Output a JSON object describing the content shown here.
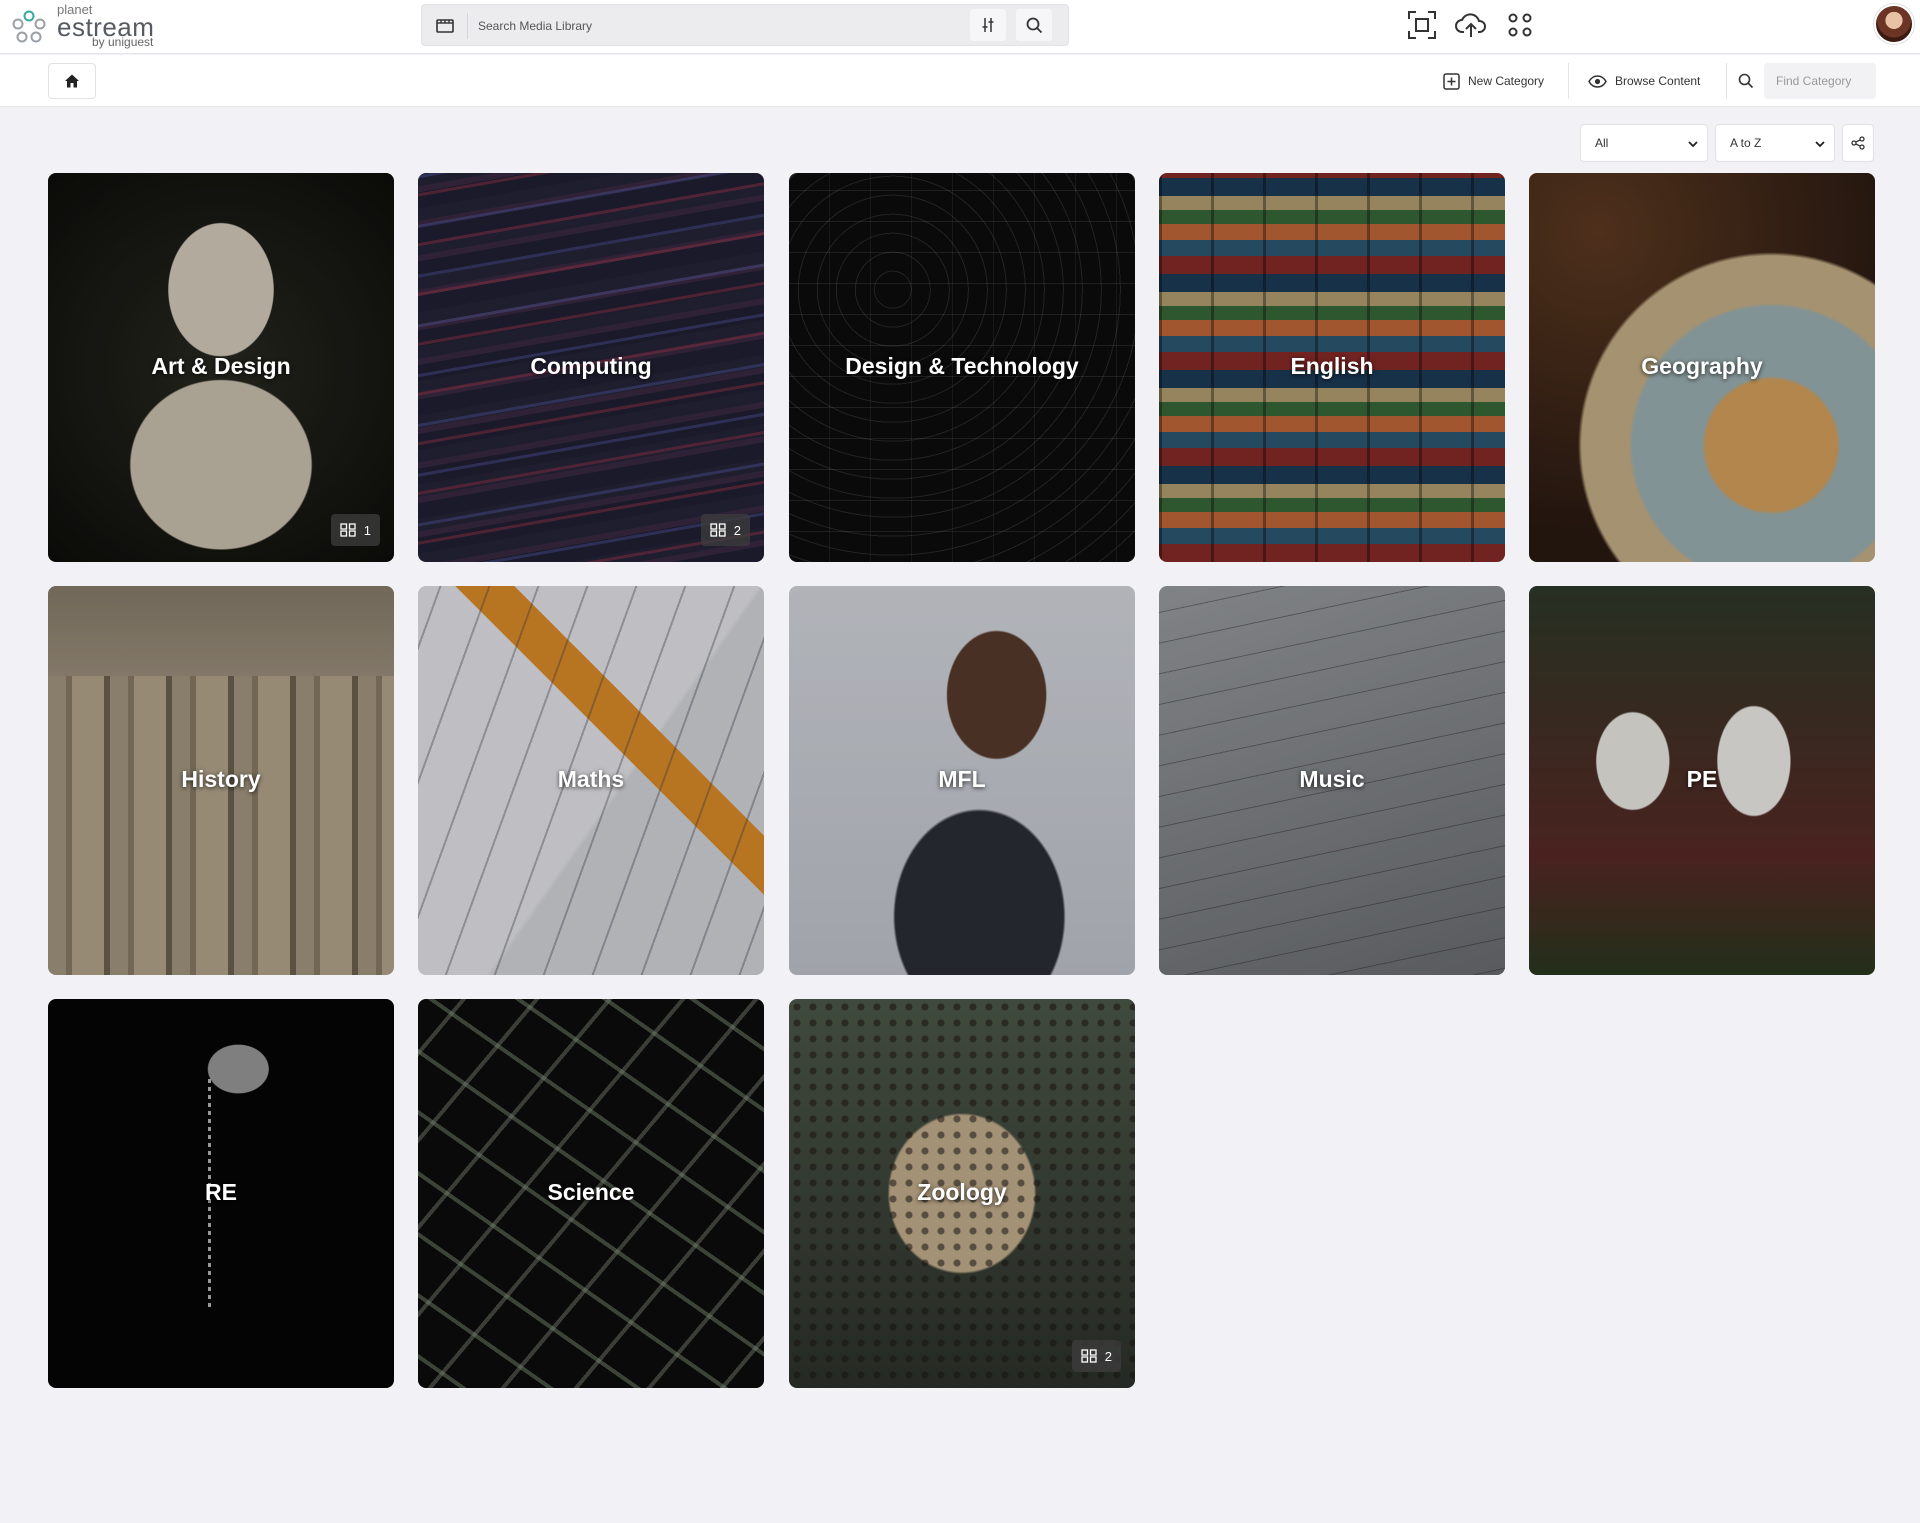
{
  "brand": {
    "small": "planet",
    "name": "estream",
    "by": "by uniguest"
  },
  "search": {
    "placeholder": "Search Media Library"
  },
  "subbar": {
    "new_category": "New Category",
    "browse_content": "Browse Content",
    "find_placeholder": "Find Category"
  },
  "controls": {
    "filter_value": "All",
    "sort_value": "A to Z"
  },
  "categories": [
    {
      "label": "Art & Design",
      "count": "1",
      "image": "marble-bust"
    },
    {
      "label": "Computing",
      "count": "2",
      "image": "code-screen"
    },
    {
      "label": "Design & Technology",
      "image": "chalkboard-sketches"
    },
    {
      "label": "English",
      "image": "book-stacks"
    },
    {
      "label": "Geography",
      "image": "globe"
    },
    {
      "label": "History",
      "image": "greek-columns"
    },
    {
      "label": "Maths",
      "image": "arithmetic-paper"
    },
    {
      "label": "MFL",
      "image": "woman-meditating"
    },
    {
      "label": "Music",
      "image": "sheet-music"
    },
    {
      "label": "PE",
      "image": "runners"
    },
    {
      "label": "RE",
      "image": "rosary"
    },
    {
      "label": "Science",
      "image": "molecular-model"
    },
    {
      "label": "Zoology",
      "count": "2",
      "image": "leopard"
    }
  ],
  "colors": {
    "background": "#f2f1f5",
    "brand_teal": "#39a8a0",
    "text": "#2b2b33"
  }
}
